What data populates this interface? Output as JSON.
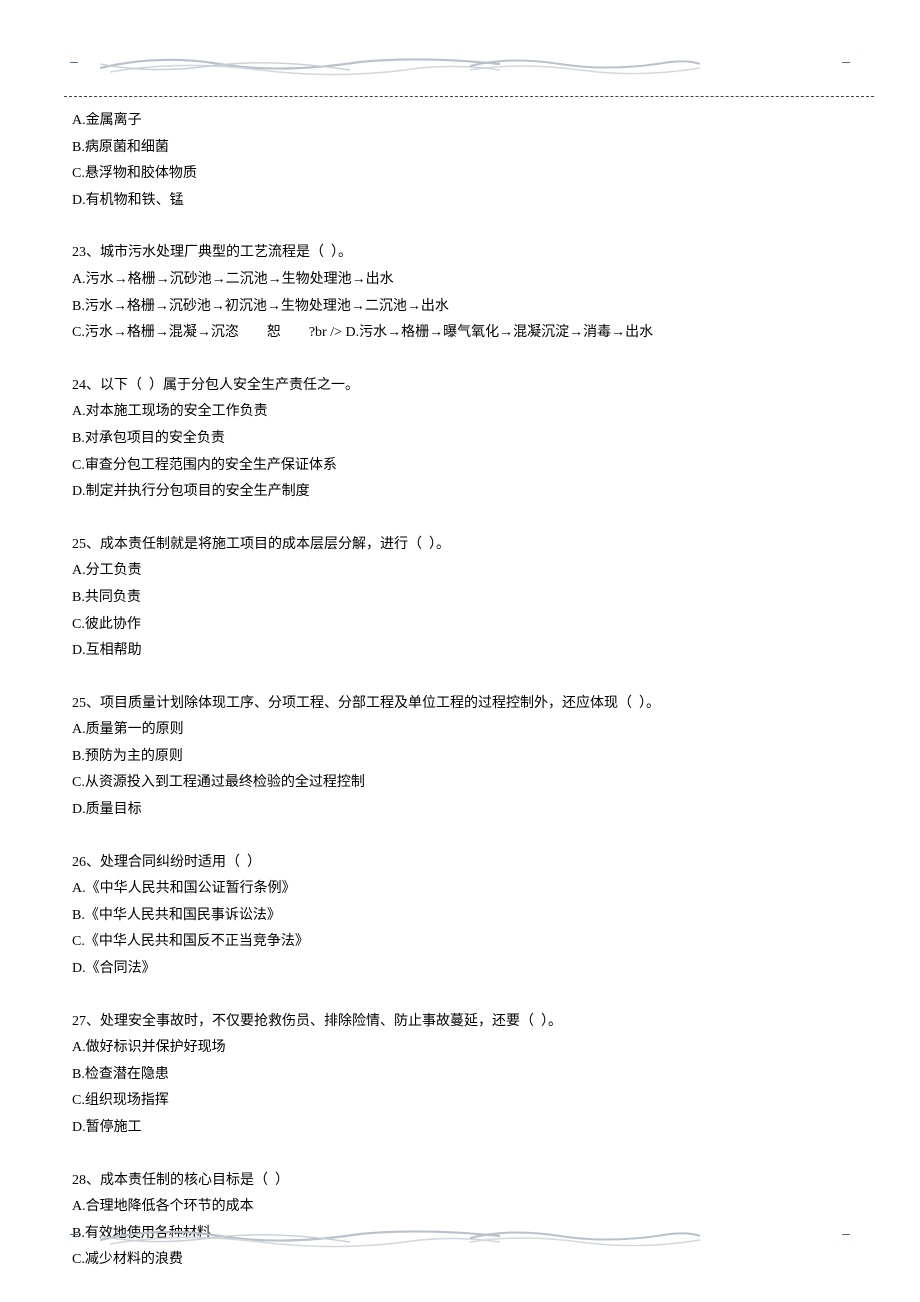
{
  "q22": {
    "a": "A.金属离子",
    "b": "B.病原菌和细菌",
    "c": "C.悬浮物和胶体物质",
    "d": "D.有机物和铁、锰"
  },
  "q23": {
    "stem": "23、城市污水处理厂典型的工艺流程是（  ）。",
    "a": "A.污水→格栅→沉砂池→二沉池→生物处理池→出水",
    "b": "B.污水→格栅→沉砂池→初沉池→生物处理池→二沉池→出水",
    "c": "C.污水→格栅→混凝→沉恣　　恕　　?br /> D.污水→格栅→曝气氧化→混凝沉淀→消毒→出水"
  },
  "q24": {
    "stem": "24、以下（  ）属于分包人安全生产责任之一。",
    "a": "A.对本施工现场的安全工作负责",
    "b": "B.对承包项目的安全负责",
    "c": "C.审查分包工程范围内的安全生产保证体系",
    "d": "D.制定并执行分包项目的安全生产制度"
  },
  "q25a": {
    "stem": "25、成本责任制就是将施工项目的成本层层分解，进行（  ）。",
    "a": "A.分工负责",
    "b": "B.共同负责",
    "c": "C.彼此协作",
    "d": "D.互相帮助"
  },
  "q25b": {
    "stem": "25、项目质量计划除体现工序、分项工程、分部工程及单位工程的过程控制外，还应体现（  ）。",
    "a": "A.质量第一的原则",
    "b": "B.预防为主的原则",
    "c": "C.从资源投入到工程通过最终检验的全过程控制",
    "d": "D.质量目标"
  },
  "q26": {
    "stem": "26、处理合同纠纷时适用（  ）",
    "a": "A.《中华人民共和国公证暂行条例》",
    "b": "B.《中华人民共和国民事诉讼法》",
    "c": "C.《中华人民共和国反不正当竞争法》",
    "d": "D.《合同法》"
  },
  "q27": {
    "stem": "27、处理安全事故时，不仅要抢救伤员、排除险情、防止事故蔓延，还要（  ）。",
    "a": "A.做好标识并保护好现场",
    "b": "B.检查潜在隐患",
    "c": "C.组织现场指挥",
    "d": "D.暂停施工"
  },
  "q28": {
    "stem": "28、成本责任制的核心目标是（  ）",
    "a": "A.合理地降低各个环节的成本",
    "b": "B.有效地使用各种材料",
    "c": "C.减少材料的浪费"
  }
}
